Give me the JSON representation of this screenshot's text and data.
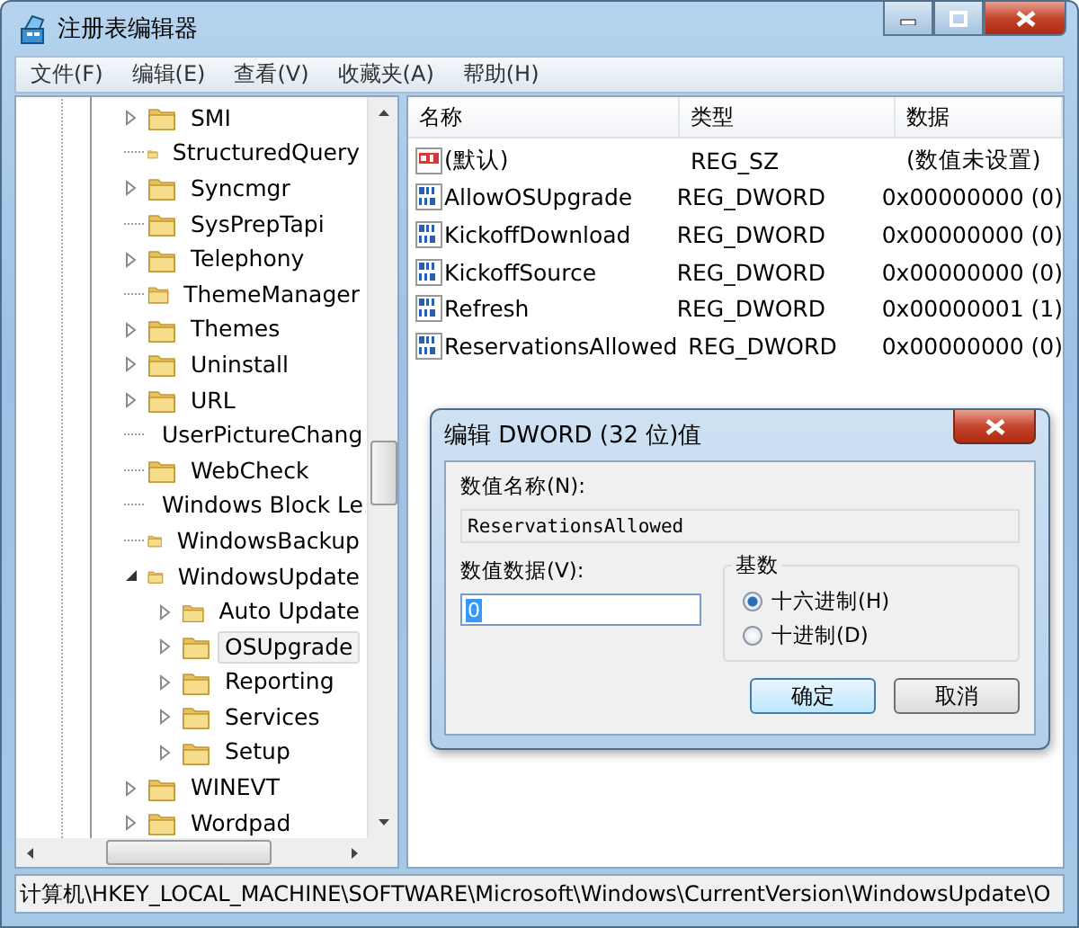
{
  "window": {
    "title": "注册表编辑器"
  },
  "menu": [
    "文件(F)",
    "编辑(E)",
    "查看(V)",
    "收藏夹(A)",
    "帮助(H)"
  ],
  "tree": [
    {
      "label": "SMI",
      "has_children": true,
      "expanded": false,
      "selected": false
    },
    {
      "label": "StructuredQuery",
      "has_children": false,
      "selected": false
    },
    {
      "label": "Syncmgr",
      "has_children": true,
      "expanded": false,
      "selected": false
    },
    {
      "label": "SysPrepTapi",
      "has_children": false,
      "selected": false
    },
    {
      "label": "Telephony",
      "has_children": true,
      "expanded": false,
      "selected": false
    },
    {
      "label": "ThemeManager",
      "has_children": false,
      "selected": false
    },
    {
      "label": "Themes",
      "has_children": true,
      "expanded": false,
      "selected": false
    },
    {
      "label": "Uninstall",
      "has_children": true,
      "expanded": false,
      "selected": false
    },
    {
      "label": "URL",
      "has_children": true,
      "expanded": false,
      "selected": false
    },
    {
      "label": "UserPictureChang",
      "has_children": false,
      "selected": false
    },
    {
      "label": "WebCheck",
      "has_children": false,
      "selected": false
    },
    {
      "label": "Windows Block Le",
      "has_children": false,
      "selected": false
    },
    {
      "label": "WindowsBackup",
      "has_children": false,
      "selected": false
    },
    {
      "label": "WindowsUpdate",
      "has_children": true,
      "expanded": true,
      "selected": false,
      "children": [
        {
          "label": "Auto Update",
          "has_children": true,
          "expanded": false,
          "selected": false
        },
        {
          "label": "OSUpgrade",
          "has_children": true,
          "expanded": false,
          "selected": true
        },
        {
          "label": "Reporting",
          "has_children": true,
          "expanded": false,
          "selected": false
        },
        {
          "label": "Services",
          "has_children": true,
          "expanded": false,
          "selected": false
        },
        {
          "label": "Setup",
          "has_children": true,
          "expanded": false,
          "selected": false
        }
      ]
    },
    {
      "label": "WINEVT",
      "has_children": true,
      "expanded": false,
      "selected": false
    },
    {
      "label": "Wordpad",
      "has_children": true,
      "expanded": false,
      "selected": false
    }
  ],
  "table": {
    "columns": [
      "名称",
      "类型",
      "数据"
    ],
    "rows": [
      {
        "kind": "string",
        "name": "(默认)",
        "type": "REG_SZ",
        "data": "(数值未设置)"
      },
      {
        "kind": "dword",
        "name": "AllowOSUpgrade",
        "type": "REG_DWORD",
        "data": "0x00000000 (0)"
      },
      {
        "kind": "dword",
        "name": "KickoffDownload",
        "type": "REG_DWORD",
        "data": "0x00000000 (0)"
      },
      {
        "kind": "dword",
        "name": "KickoffSource",
        "type": "REG_DWORD",
        "data": "0x00000000 (0)"
      },
      {
        "kind": "dword",
        "name": "Refresh",
        "type": "REG_DWORD",
        "data": "0x00000001 (1)"
      },
      {
        "kind": "dword",
        "name": "ReservationsAllowed",
        "type": "REG_DWORD",
        "data": "0x00000000 (0)"
      }
    ]
  },
  "dialog": {
    "title": "编辑 DWORD (32 位)值",
    "name_label": "数值名称(N):",
    "name_value": "ReservationsAllowed",
    "data_label": "数值数据(V):",
    "data_value": "0",
    "base_label": "基数",
    "bases": [
      {
        "label": "十六进制(H)",
        "selected": true
      },
      {
        "label": "十进制(D)",
        "selected": false
      }
    ],
    "buttons": [
      {
        "label": "确定",
        "default": true
      },
      {
        "label": "取消",
        "default": false
      }
    ]
  },
  "status_bar": "计算机\\HKEY_LOCAL_MACHINE\\SOFTWARE\\Microsoft\\Windows\\CurrentVersion\\WindowsUpdate\\O"
}
